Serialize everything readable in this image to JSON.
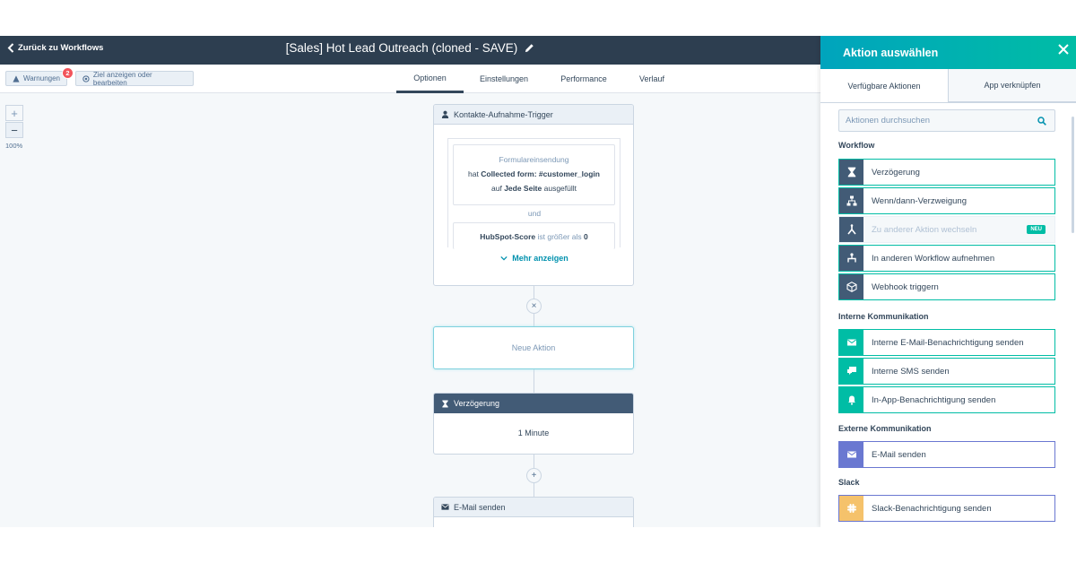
{
  "topbar": {
    "back_label": "Zurück zu Workflows",
    "workflow_title": "[Sales] Hot Lead Outreach (cloned - SAVE)"
  },
  "subbar": {
    "warnings_label": "Warnungen",
    "warnings_count": "2",
    "goal_label": "Ziel anzeigen oder bearbeiten",
    "tabs": [
      {
        "label": "Optionen",
        "active": true
      },
      {
        "label": "Einstellungen",
        "active": false
      },
      {
        "label": "Performance",
        "active": false
      },
      {
        "label": "Verlauf",
        "active": false
      }
    ]
  },
  "zoom": {
    "plus": "+",
    "minus": "−",
    "level": "100%"
  },
  "canvas": {
    "trigger": {
      "header": "Kontakte-Aufnahme-Trigger",
      "cond1_title": "Formulareinsendung",
      "cond1_pre": "hat ",
      "cond1_bold": "Collected form: #customer_login",
      "cond1_line2_pre": "auf ",
      "cond1_line2_bold": "Jede Seite",
      "cond1_line2_post": " ausgefüllt",
      "and": "und",
      "cond2_bold": "HubSpot-Score",
      "cond2_post": " ist größer als ",
      "cond2_value": "0",
      "more": "Mehr anzeigen"
    },
    "new_action": "Neue Aktion",
    "delay": {
      "header": "Verzögerung",
      "value": "1 Minute"
    },
    "email": {
      "header": "E-Mail senden"
    },
    "remove_symbol": "×",
    "add_symbol": "+"
  },
  "panel": {
    "title": "Aktion auswählen",
    "tabs": {
      "available": "Verfügbare Aktionen",
      "connect": "App verknüpfen"
    },
    "search_placeholder": "Aktionen durchsuchen",
    "sections": {
      "workflow": "Workflow",
      "internal": "Interne Kommunikation",
      "external": "Externe Kommunikation",
      "slack": "Slack"
    },
    "workflow_actions": [
      {
        "label": "Verzögerung",
        "icon": "hourglass-icon"
      },
      {
        "label": "Wenn/dann-Verzweigung",
        "icon": "branch-icon"
      },
      {
        "label": "Zu anderer Aktion wechseln",
        "icon": "goto-icon",
        "badge": "NEU"
      },
      {
        "label": "In anderen Workflow aufnehmen",
        "icon": "enroll-icon"
      },
      {
        "label": "Webhook triggern",
        "icon": "webhook-icon"
      }
    ],
    "internal_actions": [
      {
        "label": "Interne E-Mail-Benachrichtigung senden",
        "icon": "envelope-icon"
      },
      {
        "label": "Interne SMS senden",
        "icon": "sms-icon"
      },
      {
        "label": "In-App-Benachrichtigung senden",
        "icon": "bell-icon"
      }
    ],
    "external_actions": [
      {
        "label": "E-Mail senden",
        "icon": "envelope-icon"
      }
    ],
    "slack_actions": [
      {
        "label": "Slack-Benachrichtigung senden",
        "icon": "slack-icon"
      }
    ]
  },
  "colors": {
    "nav_dark": "#2d3e50",
    "teal": "#00bda5",
    "workflow_icon_bg": "#425b76",
    "internal_icon_bg": "#00bda5",
    "external_icon_bg": "#6a78d1",
    "slack_icon_bg": "#f5c26b"
  }
}
